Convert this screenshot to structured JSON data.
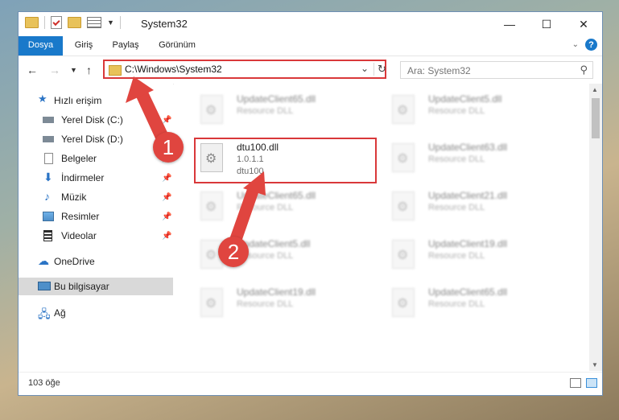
{
  "titlebar": {
    "title": "System32",
    "minimize": "—",
    "maximize": "☐",
    "close": "✕"
  },
  "ribbon": {
    "tabs": [
      "Dosya",
      "Giriş",
      "Paylaş",
      "Görünüm"
    ],
    "help": "?"
  },
  "address": {
    "path": "C:\\Windows\\System32",
    "search_placeholder": "Ara: System32"
  },
  "nav": {
    "items": [
      {
        "label": "Hızlı erişim",
        "icon": "star-icon",
        "pinned": false
      },
      {
        "label": "Yerel Disk (C:)",
        "icon": "drive-icon",
        "pinned": true
      },
      {
        "label": "Yerel Disk (D:)",
        "icon": "drive-icon",
        "pinned": false
      },
      {
        "label": "Belgeler",
        "icon": "documents-icon",
        "pinned": true
      },
      {
        "label": "İndirmeler",
        "icon": "download-icon",
        "pinned": true
      },
      {
        "label": "Müzik",
        "icon": "music-icon",
        "pinned": true
      },
      {
        "label": "Resimler",
        "icon": "pictures-icon",
        "pinned": true
      },
      {
        "label": "Videolar",
        "icon": "video-icon",
        "pinned": true
      },
      {
        "label": "OneDrive",
        "icon": "cloud-icon",
        "pinned": false
      },
      {
        "label": "Bu bilgisayar",
        "icon": "computer-icon",
        "pinned": false,
        "selected": true
      },
      {
        "label": "Ağ",
        "icon": "network-icon",
        "pinned": false
      }
    ]
  },
  "files": {
    "left": [
      {
        "name": "UpdateClient65.dll",
        "desc": "Resource DLL"
      },
      {
        "name": "dtu100.dll",
        "version": "1.0.1.1",
        "desc": "dtu100"
      },
      {
        "name": "UpdateClient65.dll",
        "desc": "Resource DLL"
      },
      {
        "name": "UpdateClient5.dll",
        "desc": "Resource DLL"
      },
      {
        "name": "UpdateClient19.dll",
        "desc": "Resource DLL"
      }
    ],
    "right": [
      {
        "name": "UpdateClient5.dll",
        "desc": "Resource DLL"
      },
      {
        "name": "UpdateClient63.dll",
        "desc": "Resource DLL"
      },
      {
        "name": "UpdateClient21.dll",
        "desc": "Resource DLL"
      },
      {
        "name": "UpdateClient19.dll",
        "desc": "Resource DLL"
      },
      {
        "name": "UpdateClient65.dll",
        "desc": "Resource DLL"
      }
    ]
  },
  "status": {
    "count": "103 öğe"
  },
  "annotations": {
    "badge1": "1",
    "badge2": "2"
  },
  "colors": {
    "accent": "#1979ca",
    "highlight": "#d9383a",
    "annotation": "#e0453f"
  }
}
